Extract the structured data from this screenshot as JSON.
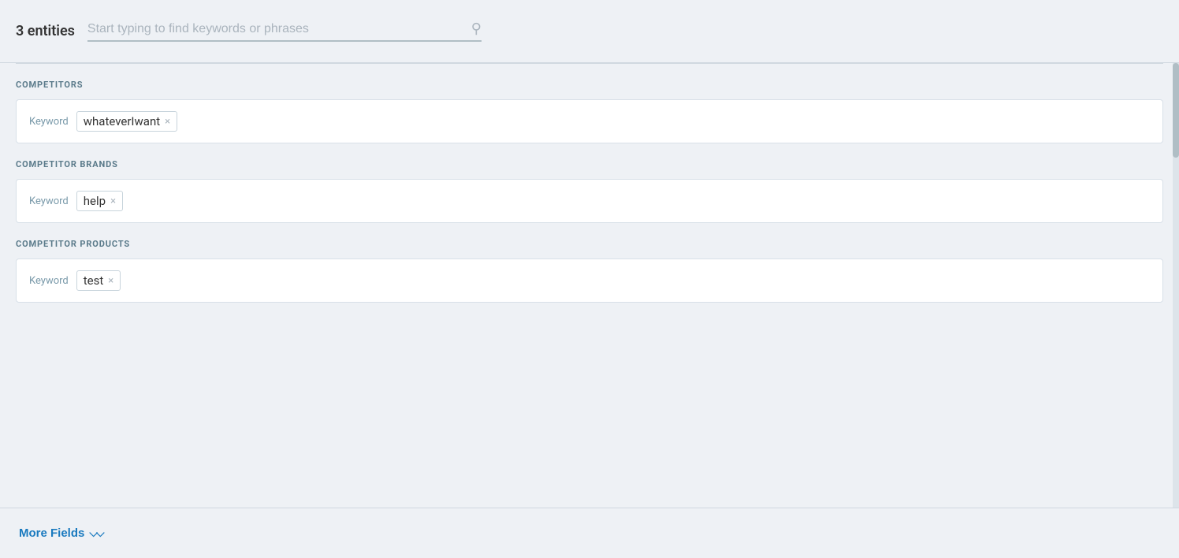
{
  "header": {
    "entity_count": "3 entities",
    "search_placeholder": "Start typing to find keywords or phrases"
  },
  "sections": [
    {
      "id": "competitors",
      "title": "COMPETITORS",
      "keyword_label": "Keyword",
      "tags": [
        {
          "value": "whateverIwant"
        }
      ]
    },
    {
      "id": "competitor-brands",
      "title": "COMPETITOR BRANDS",
      "keyword_label": "Keyword",
      "tags": [
        {
          "value": "help"
        }
      ]
    },
    {
      "id": "competitor-products",
      "title": "COMPETITOR PRODUCTS",
      "keyword_label": "Keyword",
      "tags": [
        {
          "value": "test"
        }
      ]
    }
  ],
  "footer": {
    "more_fields_label": "More Fields",
    "chevron_icon": "⌄⌄"
  },
  "icons": {
    "search": "🔍",
    "close": "×"
  }
}
